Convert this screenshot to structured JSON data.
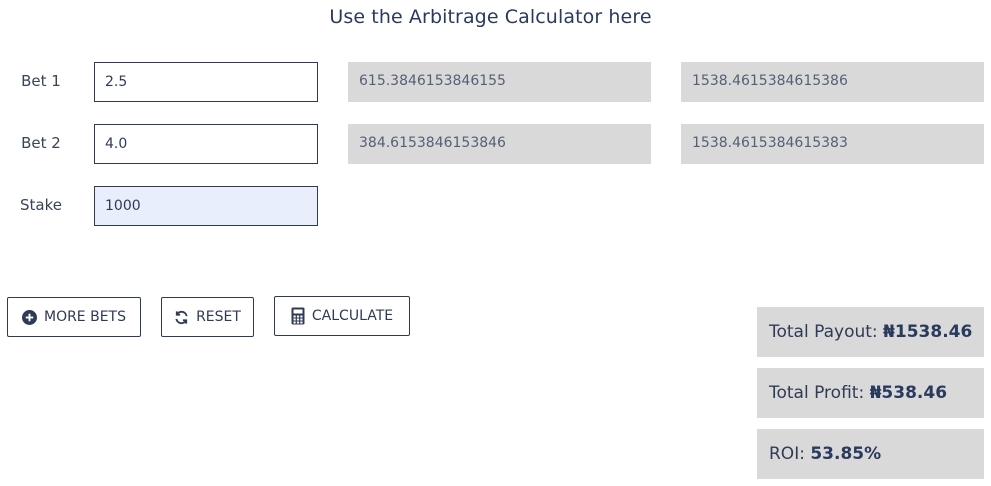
{
  "header": {
    "title": "Use the Arbitrage Calculator here"
  },
  "rows": [
    {
      "label": "Bet 1",
      "value": "2.5",
      "stake_output": "615.3846153846155",
      "payout_output": "1538.4615384615386"
    },
    {
      "label": "Bet 2",
      "value": "4.0",
      "stake_output": "384.6153846153846",
      "payout_output": "1538.4615384615383"
    }
  ],
  "stake": {
    "label": "Stake",
    "value": "1000"
  },
  "buttons": {
    "more_bets": "MORE BETS",
    "reset": "RESET",
    "calculate": "CALCULATE"
  },
  "summary": {
    "payout_label": "Total Payout:",
    "payout_value": "₦1538.46",
    "profit_label": "Total Profit:",
    "profit_value": "₦538.46",
    "roi_label": "ROI:",
    "roi_value": "53.85%"
  },
  "icons": {
    "more_bets": "plus-circle-icon",
    "reset": "refresh-icon",
    "calculate": "calculator-icon"
  },
  "colors": {
    "text": "#2f3b55",
    "output_bg": "#d9d9d9",
    "active_input_bg": "#e8eefb"
  }
}
